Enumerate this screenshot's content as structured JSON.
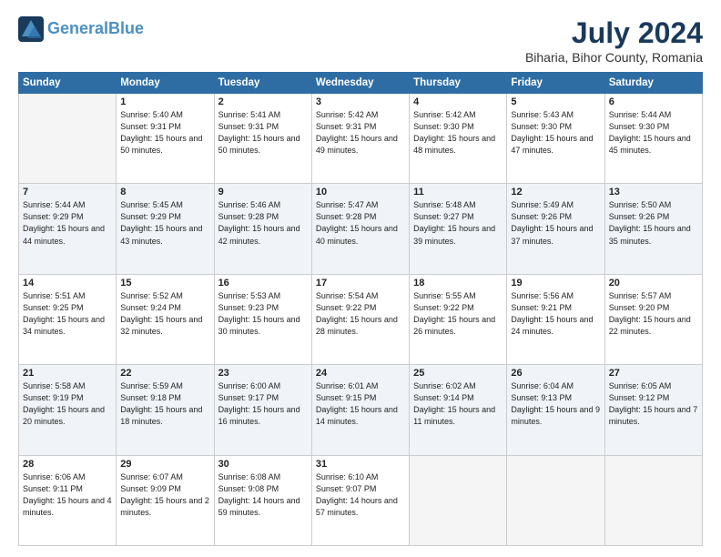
{
  "header": {
    "logo_line1": "General",
    "logo_line2": "Blue",
    "month_year": "July 2024",
    "location": "Biharia, Bihor County, Romania"
  },
  "days_of_week": [
    "Sunday",
    "Monday",
    "Tuesday",
    "Wednesday",
    "Thursday",
    "Friday",
    "Saturday"
  ],
  "weeks": [
    [
      {
        "day": "",
        "content": ""
      },
      {
        "day": "1",
        "content": "Sunrise: 5:40 AM\nSunset: 9:31 PM\nDaylight: 15 hours\nand 50 minutes."
      },
      {
        "day": "2",
        "content": "Sunrise: 5:41 AM\nSunset: 9:31 PM\nDaylight: 15 hours\nand 50 minutes."
      },
      {
        "day": "3",
        "content": "Sunrise: 5:42 AM\nSunset: 9:31 PM\nDaylight: 15 hours\nand 49 minutes."
      },
      {
        "day": "4",
        "content": "Sunrise: 5:42 AM\nSunset: 9:30 PM\nDaylight: 15 hours\nand 48 minutes."
      },
      {
        "day": "5",
        "content": "Sunrise: 5:43 AM\nSunset: 9:30 PM\nDaylight: 15 hours\nand 47 minutes."
      },
      {
        "day": "6",
        "content": "Sunrise: 5:44 AM\nSunset: 9:30 PM\nDaylight: 15 hours\nand 45 minutes."
      }
    ],
    [
      {
        "day": "7",
        "content": "Sunrise: 5:44 AM\nSunset: 9:29 PM\nDaylight: 15 hours\nand 44 minutes."
      },
      {
        "day": "8",
        "content": "Sunrise: 5:45 AM\nSunset: 9:29 PM\nDaylight: 15 hours\nand 43 minutes."
      },
      {
        "day": "9",
        "content": "Sunrise: 5:46 AM\nSunset: 9:28 PM\nDaylight: 15 hours\nand 42 minutes."
      },
      {
        "day": "10",
        "content": "Sunrise: 5:47 AM\nSunset: 9:28 PM\nDaylight: 15 hours\nand 40 minutes."
      },
      {
        "day": "11",
        "content": "Sunrise: 5:48 AM\nSunset: 9:27 PM\nDaylight: 15 hours\nand 39 minutes."
      },
      {
        "day": "12",
        "content": "Sunrise: 5:49 AM\nSunset: 9:26 PM\nDaylight: 15 hours\nand 37 minutes."
      },
      {
        "day": "13",
        "content": "Sunrise: 5:50 AM\nSunset: 9:26 PM\nDaylight: 15 hours\nand 35 minutes."
      }
    ],
    [
      {
        "day": "14",
        "content": "Sunrise: 5:51 AM\nSunset: 9:25 PM\nDaylight: 15 hours\nand 34 minutes."
      },
      {
        "day": "15",
        "content": "Sunrise: 5:52 AM\nSunset: 9:24 PM\nDaylight: 15 hours\nand 32 minutes."
      },
      {
        "day": "16",
        "content": "Sunrise: 5:53 AM\nSunset: 9:23 PM\nDaylight: 15 hours\nand 30 minutes."
      },
      {
        "day": "17",
        "content": "Sunrise: 5:54 AM\nSunset: 9:22 PM\nDaylight: 15 hours\nand 28 minutes."
      },
      {
        "day": "18",
        "content": "Sunrise: 5:55 AM\nSunset: 9:22 PM\nDaylight: 15 hours\nand 26 minutes."
      },
      {
        "day": "19",
        "content": "Sunrise: 5:56 AM\nSunset: 9:21 PM\nDaylight: 15 hours\nand 24 minutes."
      },
      {
        "day": "20",
        "content": "Sunrise: 5:57 AM\nSunset: 9:20 PM\nDaylight: 15 hours\nand 22 minutes."
      }
    ],
    [
      {
        "day": "21",
        "content": "Sunrise: 5:58 AM\nSunset: 9:19 PM\nDaylight: 15 hours\nand 20 minutes."
      },
      {
        "day": "22",
        "content": "Sunrise: 5:59 AM\nSunset: 9:18 PM\nDaylight: 15 hours\nand 18 minutes."
      },
      {
        "day": "23",
        "content": "Sunrise: 6:00 AM\nSunset: 9:17 PM\nDaylight: 15 hours\nand 16 minutes."
      },
      {
        "day": "24",
        "content": "Sunrise: 6:01 AM\nSunset: 9:15 PM\nDaylight: 15 hours\nand 14 minutes."
      },
      {
        "day": "25",
        "content": "Sunrise: 6:02 AM\nSunset: 9:14 PM\nDaylight: 15 hours\nand 11 minutes."
      },
      {
        "day": "26",
        "content": "Sunrise: 6:04 AM\nSunset: 9:13 PM\nDaylight: 15 hours\nand 9 minutes."
      },
      {
        "day": "27",
        "content": "Sunrise: 6:05 AM\nSunset: 9:12 PM\nDaylight: 15 hours\nand 7 minutes."
      }
    ],
    [
      {
        "day": "28",
        "content": "Sunrise: 6:06 AM\nSunset: 9:11 PM\nDaylight: 15 hours\nand 4 minutes."
      },
      {
        "day": "29",
        "content": "Sunrise: 6:07 AM\nSunset: 9:09 PM\nDaylight: 15 hours\nand 2 minutes."
      },
      {
        "day": "30",
        "content": "Sunrise: 6:08 AM\nSunset: 9:08 PM\nDaylight: 14 hours\nand 59 minutes."
      },
      {
        "day": "31",
        "content": "Sunrise: 6:10 AM\nSunset: 9:07 PM\nDaylight: 14 hours\nand 57 minutes."
      },
      {
        "day": "",
        "content": ""
      },
      {
        "day": "",
        "content": ""
      },
      {
        "day": "",
        "content": ""
      }
    ]
  ]
}
